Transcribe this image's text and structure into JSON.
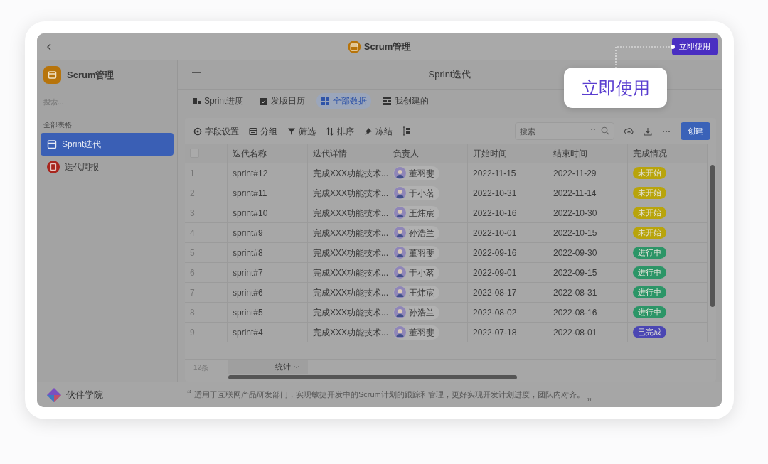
{
  "window": {
    "title": "Scrum管理",
    "action_button": "立即使用"
  },
  "callout": {
    "text": "立即使用"
  },
  "sidebar": {
    "app_name": "Scrum管理",
    "search": {
      "placeholder": "搜索..."
    },
    "section": "全部表格",
    "items": [
      {
        "label": "Sprint迭代",
        "selected": true
      },
      {
        "label": "迭代周报",
        "selected": false
      }
    ]
  },
  "main": {
    "title": "Sprint迭代"
  },
  "views": [
    {
      "label": "Sprint进度",
      "selected": false
    },
    {
      "label": "发版日历",
      "selected": false
    },
    {
      "label": "全部数据",
      "selected": true
    },
    {
      "label": "我创建的",
      "selected": false
    }
  ],
  "toolbar": {
    "actions": [
      "字段设置",
      "分组",
      "筛选",
      "排序",
      "冻结"
    ],
    "search": {
      "placeholder": "搜索"
    },
    "create_button": "创建"
  },
  "table": {
    "header_checkbox": {
      "checked": false
    },
    "columns": [
      "迭代名称",
      "迭代详情",
      "负责人",
      "开始时间",
      "结束时间",
      "完成情况"
    ],
    "rows": [
      {
        "index": "1",
        "name": "sprint#12",
        "detail": "完成XXX功能技术...",
        "owner": "董羽斐",
        "start": "2022-11-15",
        "end": "2022-11-29",
        "status": {
          "label": "未开始",
          "color": "#b8a40c"
        }
      },
      {
        "index": "2",
        "name": "sprint#11",
        "detail": "完成XXX功能技术...",
        "owner": "于小茗",
        "start": "2022-10-31",
        "end": "2022-11-14",
        "status": {
          "label": "未开始",
          "color": "#b8a40c"
        }
      },
      {
        "index": "3",
        "name": "sprint#10",
        "detail": "完成XXX功能技术...",
        "owner": "王炜宸",
        "start": "2022-10-16",
        "end": "2022-10-30",
        "status": {
          "label": "未开始",
          "color": "#b8a40c"
        }
      },
      {
        "index": "4",
        "name": "sprint#9",
        "detail": "完成XXX功能技术...",
        "owner": "孙浩兰",
        "start": "2022-10-01",
        "end": "2022-10-15",
        "status": {
          "label": "未开始",
          "color": "#b8a40c"
        }
      },
      {
        "index": "5",
        "name": "sprint#8",
        "detail": "完成XXX功能技术...",
        "owner": "董羽斐",
        "start": "2022-09-16",
        "end": "2022-09-30",
        "status": {
          "label": "进行中",
          "color": "#2c9567"
        }
      },
      {
        "index": "6",
        "name": "sprint#7",
        "detail": "完成XXX功能技术...",
        "owner": "于小茗",
        "start": "2022-09-01",
        "end": "2022-09-15",
        "status": {
          "label": "进行中",
          "color": "#2c9567"
        }
      },
      {
        "index": "7",
        "name": "sprint#6",
        "detail": "完成XXX功能技术...",
        "owner": "王炜宸",
        "start": "2022-08-17",
        "end": "2022-08-31",
        "status": {
          "label": "进行中",
          "color": "#2c9567"
        }
      },
      {
        "index": "8",
        "name": "sprint#5",
        "detail": "完成XXX功能技术...",
        "owner": "孙浩兰",
        "start": "2022-08-02",
        "end": "2022-08-16",
        "status": {
          "label": "进行中",
          "color": "#2c9567"
        }
      },
      {
        "index": "9",
        "name": "sprint#4",
        "detail": "完成XXX功能技术...",
        "owner": "董羽斐",
        "start": "2022-07-18",
        "end": "2022-08-01",
        "status": {
          "label": "已完成",
          "color": "#4b46b3"
        }
      }
    ],
    "footer": {
      "count": "12条",
      "stat": "统计"
    }
  },
  "footer": {
    "brand": "伙伴学院",
    "open_quote": "“",
    "quote": "适用于互联网产品研发部门，实现敏捷开发中的Scrum计划的跟踪和管理，更好实现开发计划进度，团队内对齐。",
    "close_quote": "„"
  }
}
